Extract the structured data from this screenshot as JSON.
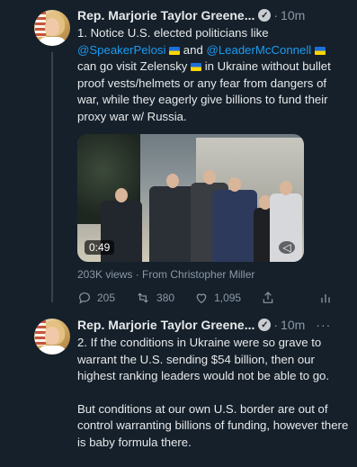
{
  "tweet1": {
    "name": "Rep. Marjorie Taylor Greene...",
    "separator": "·",
    "time": "10m",
    "text_parts": {
      "p1": "1. Notice U.S. elected politicians like ",
      "mention1": "@SpeakerPelosi",
      "p2": " and ",
      "mention2": "@LeaderMcConnell",
      "p3": " can go visit Zelensky ",
      "p4": " in Ukraine without bullet proof vests/helmets or any fear from dangers of war, while they eagerly give billions to fund their proxy war w/ Russia."
    },
    "video_duration": "0:49",
    "views": "203K views · From Christopher Miller",
    "actions": {
      "replies": "205",
      "retweets": "380",
      "likes": "1,095"
    }
  },
  "tweet2": {
    "name": "Rep. Marjorie Taylor Greene...",
    "separator": "·",
    "time": "10m",
    "more": "···",
    "paragraph1": "2. If the conditions in Ukraine were so grave to warrant the U.S. sending $54 billion, then our highest ranking leaders would not be able to go.",
    "paragraph2": "But conditions at our own U.S. border are out of control warranting billions of funding, however there is baby formula there."
  },
  "colors": {
    "background": "#15202b",
    "link": "#1d9bf0",
    "muted": "#8b98a5"
  }
}
